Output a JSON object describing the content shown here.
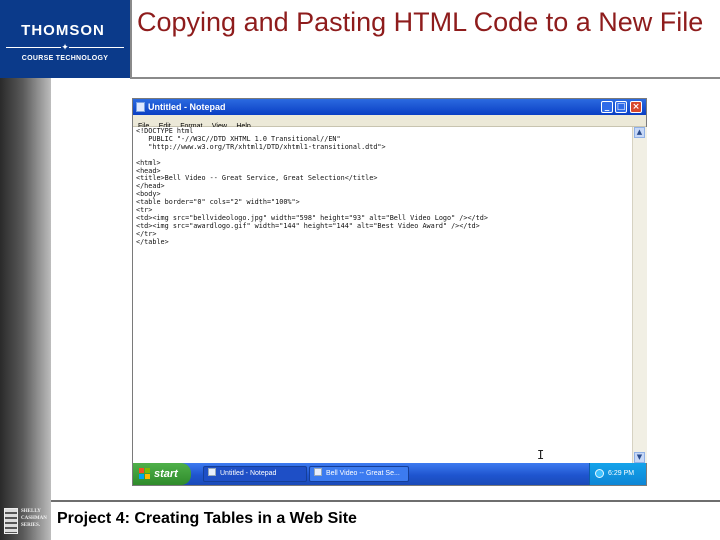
{
  "slide": {
    "title": "Copying and Pasting HTML Code to a New File",
    "footer": "Project 4: Creating Tables in a Web Site"
  },
  "logo": {
    "brand": "THOMSON",
    "sub": "COURSE TECHNOLOGY"
  },
  "series_logo": {
    "lines": [
      "SHELLY",
      "CASHMAN",
      "SERIES."
    ]
  },
  "notepad": {
    "title": "Untitled - Notepad",
    "menu": [
      "File",
      "Edit",
      "Format",
      "View",
      "Help"
    ],
    "content": "<!DOCTYPE html\n   PUBLIC \"-//W3C//DTD XHTML 1.0 Transitional//EN\"\n   \"http://www.w3.org/TR/xhtml1/DTD/xhtml1-transitional.dtd\">\n\n<html>\n<head>\n<title>Bell Video -- Great Service, Great Selection</title>\n</head>\n<body>\n<table border=\"0\" cols=\"2\" width=\"100%\">\n<tr>\n<td><img src=\"bellvideologo.jpg\" width=\"598\" height=\"93\" alt=\"Bell Video Logo\" /></td>\n<td><img src=\"awardlogo.gif\" width=\"144\" height=\"144\" alt=\"Best Video Award\" /></td>\n</tr>\n</table>",
    "window_buttons": {
      "minimize": "_",
      "maximize": "□",
      "close": "×"
    }
  },
  "taskbar": {
    "start_label": "start",
    "tasks": [
      "Untitled - Notepad",
      "Bell Video -- Great Se..."
    ],
    "clock": "6:29 PM"
  },
  "colors": {
    "title_text": "#8e1c1c",
    "logo_bg": "#0b3a8a",
    "titlebar": "#0a3fc4",
    "taskbar": "#1f55cf",
    "start_button": "#3a9a35"
  },
  "icons": {
    "app": "notepad-icon",
    "start": "windows-flag-icon",
    "tray": "network-icon",
    "cursor": "text-ibeam-cursor"
  }
}
